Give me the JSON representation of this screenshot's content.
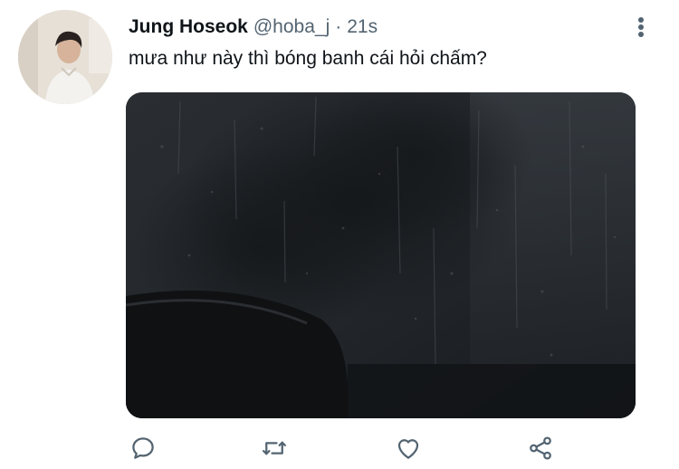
{
  "tweet": {
    "author_name": "Jung Hoseok",
    "handle": "@hoba_j",
    "separator": "·",
    "time": "21s",
    "text": "mưa như này thì bóng banh cái hỏi chấm?"
  },
  "icons": {
    "more": "more-vertical-icon",
    "reply": "reply-icon",
    "retweet": "retweet-icon",
    "like": "heart-icon",
    "share": "share-icon"
  },
  "colors": {
    "text": "#0f1419",
    "secondary": "#536471",
    "icon": "#536471"
  }
}
